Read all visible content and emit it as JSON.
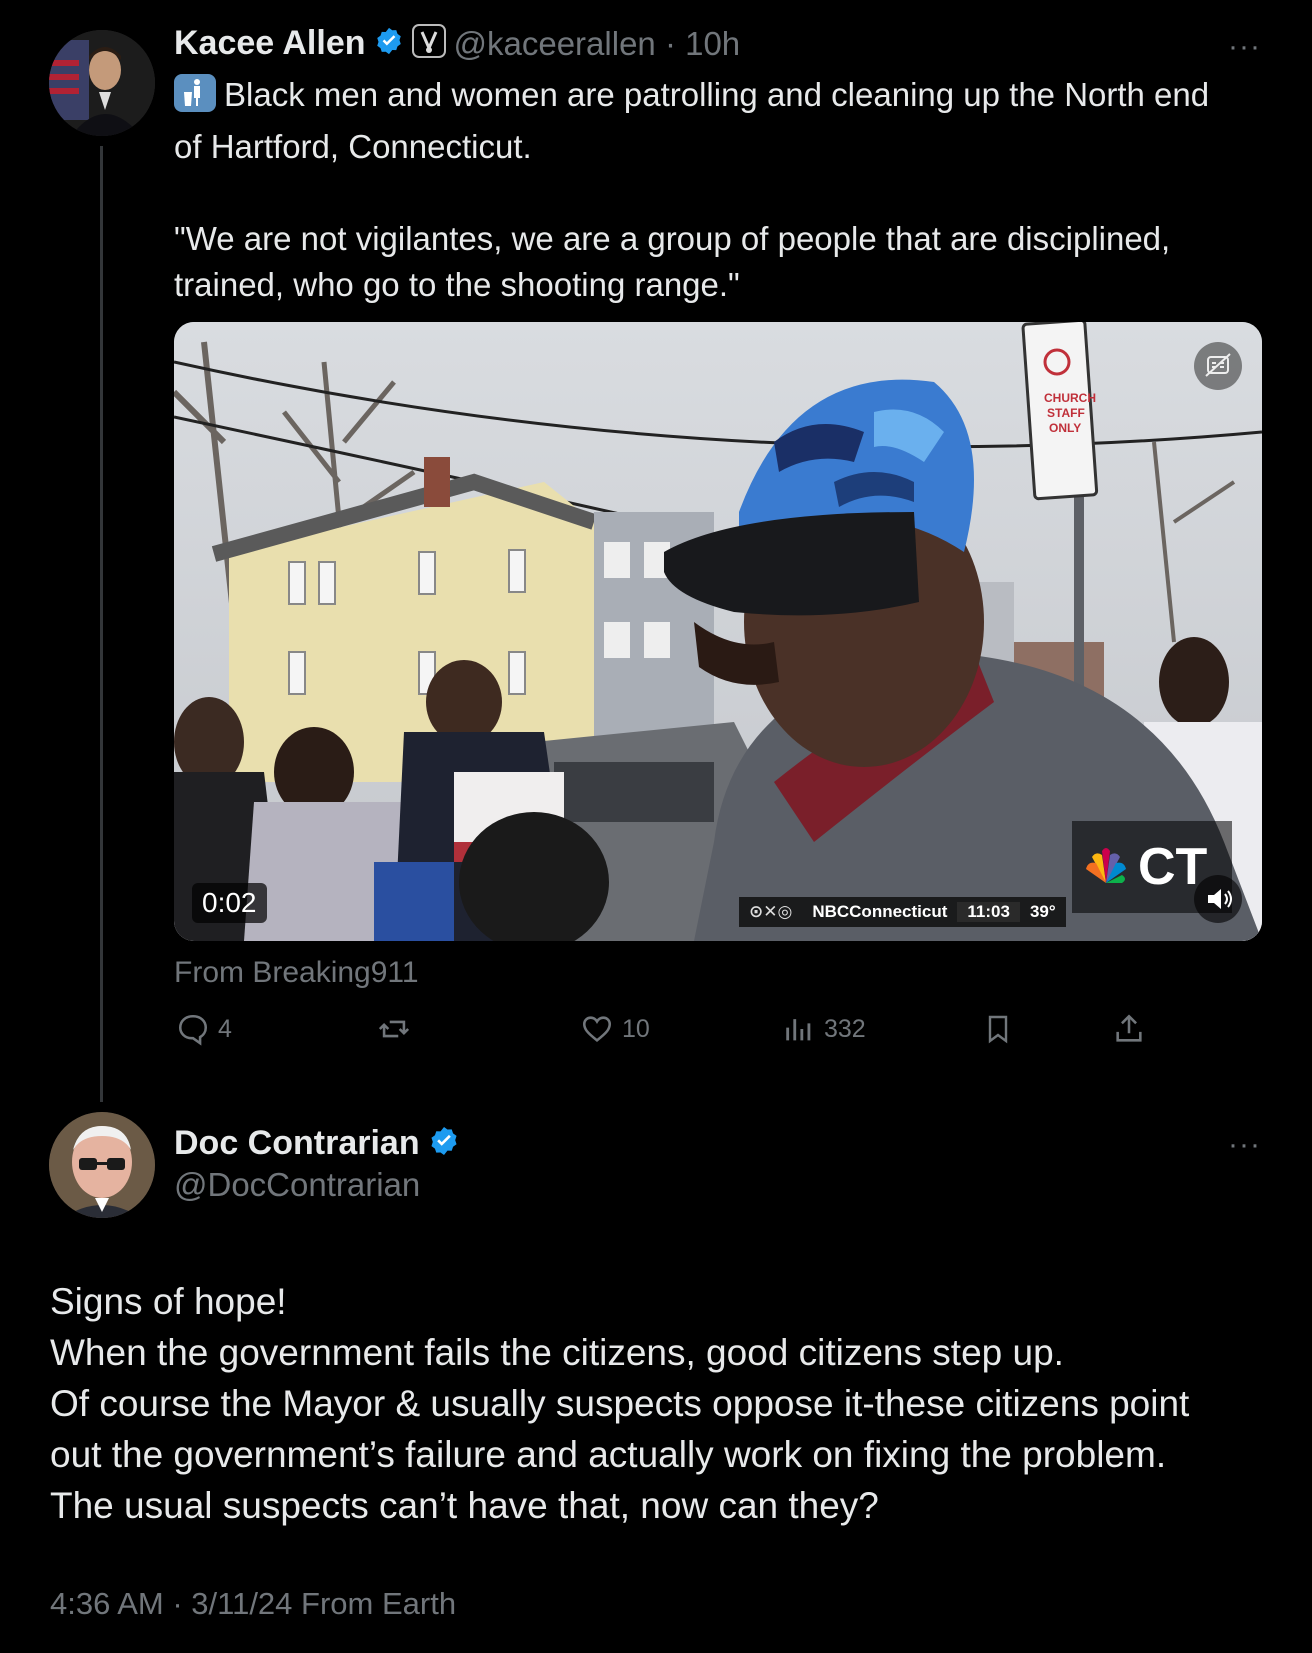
{
  "tweet1": {
    "author_name": "Kacee Allen",
    "handle_time": "@kaceerallen · 10h",
    "more_label": "···",
    "line1": "Black men and women are patrolling and cleaning up the North end",
    "line2": "of Hartford, Connecticut.",
    "quote_line1": "\"We are not vigilantes, we are a group of people that are disciplined,",
    "quote_line2": "trained, who go to the shooting range.\"",
    "video": {
      "duration": "0:02",
      "chyron_handle": "NBCConnecticut",
      "chyron_time": "11:03",
      "chyron_temp": "39°",
      "station": "CT",
      "sign_text": [
        "CHURCH",
        "STAFF",
        "ONLY"
      ]
    },
    "source": "From Breaking911",
    "actions": {
      "replies": "4",
      "reposts": "",
      "likes": "10",
      "views": "332"
    }
  },
  "tweet2": {
    "author_name": "Doc Contrarian",
    "handle": "@DocContrarian",
    "more_label": "···",
    "lines": [
      "Signs of hope!",
      "When the government fails the citizens, good citizens step up.",
      "Of course the Mayor & usually suspects oppose it-these citizens point",
      "out the government’s failure and actually work on fixing the problem.",
      "The usual suspects can’t have that, now can they?"
    ],
    "meta": "4:36 AM · 3/11/24 From Earth"
  },
  "colors": {
    "background": "#000000",
    "text": "#e7e9ea",
    "muted": "#71767b",
    "verified": "#1d9bf0"
  }
}
